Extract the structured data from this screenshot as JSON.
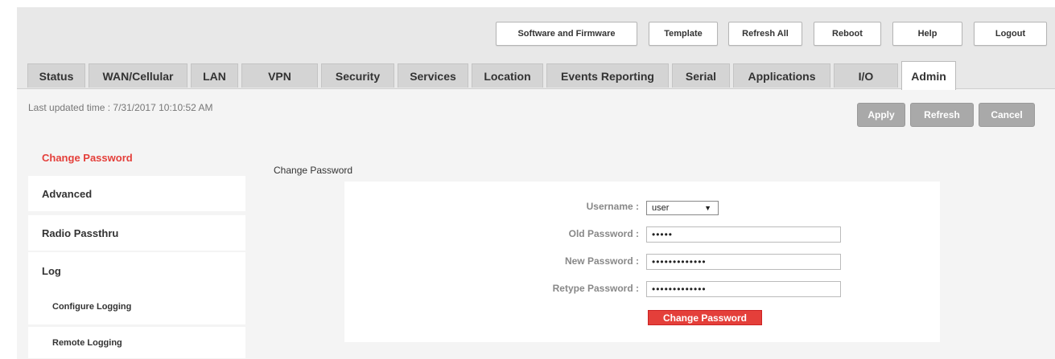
{
  "header": {
    "buttons": [
      {
        "label": "Software and Firmware"
      },
      {
        "label": "Template"
      },
      {
        "label": "Refresh All"
      },
      {
        "label": "Reboot"
      },
      {
        "label": "Help"
      },
      {
        "label": "Logout"
      }
    ]
  },
  "tabs": [
    {
      "label": "Status"
    },
    {
      "label": "WAN/Cellular"
    },
    {
      "label": "LAN"
    },
    {
      "label": "VPN"
    },
    {
      "label": "Security"
    },
    {
      "label": "Services"
    },
    {
      "label": "Location"
    },
    {
      "label": "Events Reporting"
    },
    {
      "label": "Serial"
    },
    {
      "label": "Applications"
    },
    {
      "label": "I/O"
    },
    {
      "label": "Admin"
    }
  ],
  "active_tab": "Admin",
  "status": {
    "last_updated": "Last updated time : 7/31/2017 10:10:52 AM"
  },
  "actions": {
    "apply": "Apply",
    "refresh": "Refresh",
    "cancel": "Cancel"
  },
  "sidebar": {
    "items": [
      {
        "label": "Change Password"
      },
      {
        "label": "Advanced"
      },
      {
        "label": "Radio Passthru"
      },
      {
        "label": "Log"
      },
      {
        "label": "Configure Logging"
      },
      {
        "label": "Remote Logging"
      }
    ],
    "active": "Change Password"
  },
  "form": {
    "section_title": "Change Password",
    "username_label": "Username :",
    "username_value": "user",
    "old_password_label": "Old Password :",
    "old_password_value": "•••••",
    "new_password_label": "New Password :",
    "new_password_value": "•••••••••••••",
    "retype_password_label": "Retype Password :",
    "retype_password_value": "•••••••••••••",
    "submit_label": "Change Password"
  },
  "colors": {
    "accent": "#e43f3a",
    "action_button": "#a9a9a9",
    "frame_background": "#e8e8e8"
  },
  "icons": {
    "select_arrow": "triangle-down-icon"
  }
}
